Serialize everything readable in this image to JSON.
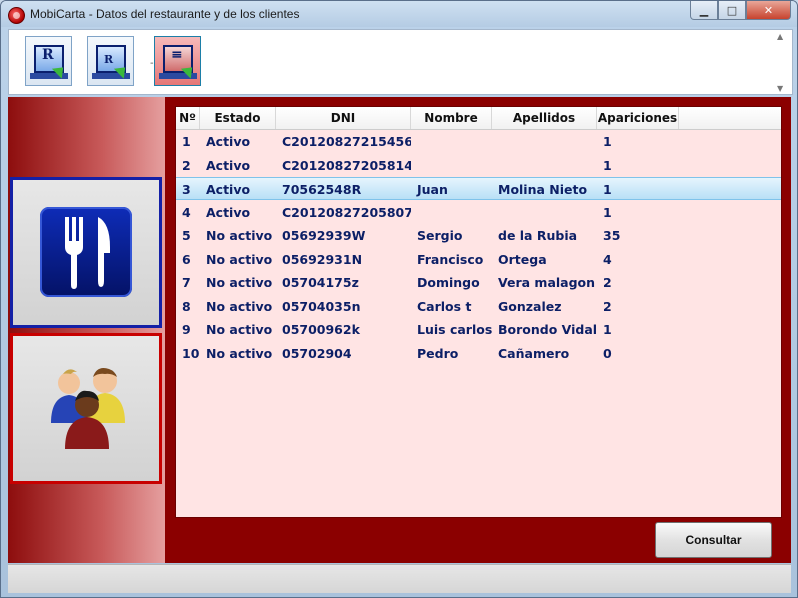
{
  "window": {
    "title": "MobiCarta - Datos del restaurante y de los clientes",
    "minimize_glyph": "▁",
    "maximize_glyph": "□",
    "close_glyph": "✕"
  },
  "toolbar": {
    "buttons": [
      {
        "icon": "monitor-r-arrow-icon",
        "glyph": "R"
      },
      {
        "icon": "monitor-db-arrow-icon",
        "glyph": "R"
      },
      {
        "icon": "monitor-db-active-icon",
        "glyph": "≡"
      }
    ],
    "separator": "-"
  },
  "sidebar": {
    "menu_icon": "fork-knife-icon",
    "clients_icon": "people-icon"
  },
  "grid": {
    "columns": [
      "Nº",
      "Estado",
      "DNI",
      "Nombre",
      "Apellidos",
      "Apariciones",
      ""
    ],
    "rows": [
      {
        "n": "1",
        "estado": "Activo",
        "dni": "C20120827215456",
        "nombre": "",
        "apellidos": "",
        "apariciones": "1"
      },
      {
        "n": "2",
        "estado": "Activo",
        "dni": "C20120827205814",
        "nombre": "",
        "apellidos": "",
        "apariciones": "1"
      },
      {
        "n": "3",
        "estado": "Activo",
        "dni": "70562548R",
        "nombre": "Juan",
        "apellidos": "Molina Nieto",
        "apariciones": "1"
      },
      {
        "n": "4",
        "estado": "Activo",
        "dni": "C20120827205807",
        "nombre": "",
        "apellidos": "",
        "apariciones": "1"
      },
      {
        "n": "5",
        "estado": "No activo",
        "dni": "05692939W",
        "nombre": "Sergio",
        "apellidos": "de la Rubia",
        "apariciones": "35"
      },
      {
        "n": "6",
        "estado": "No activo",
        "dni": "05692931N",
        "nombre": "Francisco",
        "apellidos": "Ortega",
        "apariciones": "4"
      },
      {
        "n": "7",
        "estado": "No activo",
        "dni": "05704175z",
        "nombre": "Domingo",
        "apellidos": "Vera malagon",
        "apariciones": "2"
      },
      {
        "n": "8",
        "estado": "No activo",
        "dni": "05704035n",
        "nombre": "Carlos t",
        "apellidos": "Gonzalez",
        "apariciones": "2"
      },
      {
        "n": "9",
        "estado": "No activo",
        "dni": "05700962k",
        "nombre": "Luis carlos",
        "apellidos": "Borondo Vidal",
        "apariciones": "1"
      },
      {
        "n": "10",
        "estado": "No activo",
        "dni": "05702904",
        "nombre": "Pedro",
        "apellidos": "Cañamero",
        "apariciones": "0"
      }
    ],
    "selected_row": 2
  },
  "actions": {
    "consultar_label": "Consultar"
  },
  "colors": {
    "accent_dark_red": "#8b0000",
    "grid_background": "#ffe4e4",
    "selected_row": "#b8e0f6",
    "text_blue": "#0c1f66"
  }
}
